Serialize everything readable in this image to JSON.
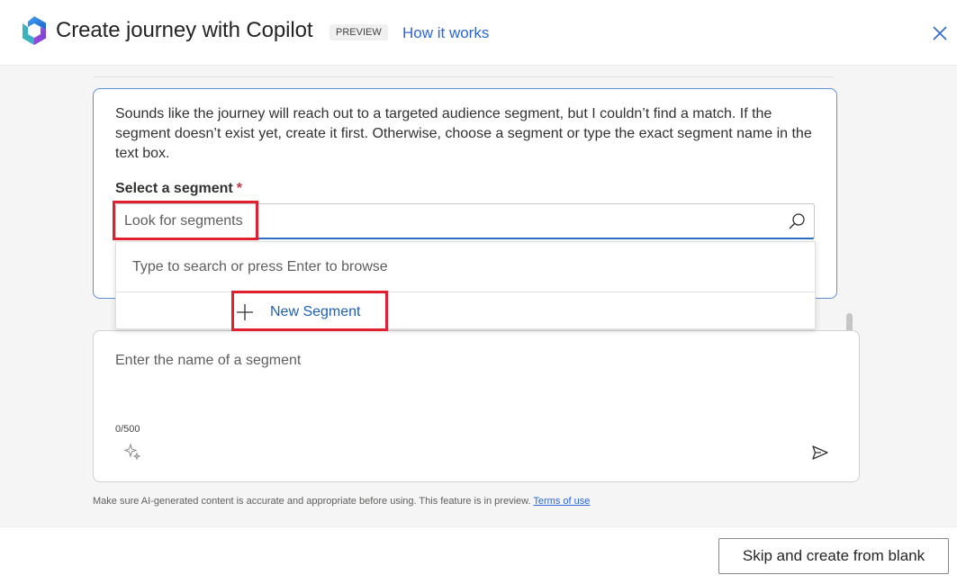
{
  "header": {
    "title": "Create journey with Copilot",
    "badge": "PREVIEW",
    "how_it_works": "How it works",
    "close_icon": "close-icon"
  },
  "message": {
    "text": "Sounds like the journey will reach out to a targeted audience segment, but I couldn’t find a match. If the segment doesn’t exist yet, create it first. Otherwise, choose a segment or type the exact segment name in the text box.",
    "segment_label": "Select a segment",
    "required_mark": "*",
    "segment_placeholder": "Look for segments",
    "search_icon": "search-icon"
  },
  "dropdown": {
    "hint": "Type to search or press Enter to browse",
    "new_segment": "New Segment",
    "plus_icon": "plus-icon"
  },
  "prompt": {
    "placeholder": "Enter the name of a segment",
    "counter": "0/500",
    "sparkle_icon": "sparkle-icon",
    "send_icon": "send-icon"
  },
  "disclaimer": {
    "text": "Make sure AI-generated content is accurate and appropriate before using. This feature is in preview.",
    "terms": "Terms of use"
  },
  "footer": {
    "skip_button": "Skip and create from blank"
  },
  "colors": {
    "accent": "#2b66d6",
    "highlight": "#e0202e",
    "required": "#c4314b"
  }
}
